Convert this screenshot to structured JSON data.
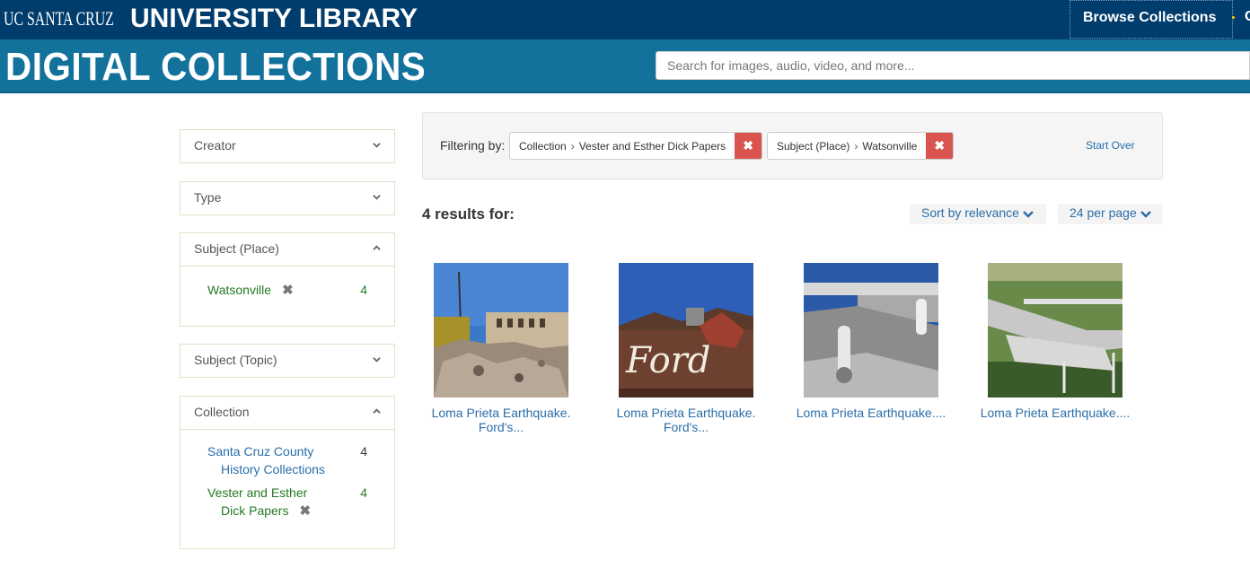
{
  "header": {
    "uc_logo": "UC SANTA CRUZ",
    "library_title": "UNIVERSITY LIBRARY",
    "browse_label": "Browse Collections",
    "more_label": "C"
  },
  "banner": {
    "title": "DIGITAL COLLECTIONS",
    "search_placeholder": "Search for images, audio, video, and more..."
  },
  "facets": {
    "creator": {
      "label": "Creator"
    },
    "type": {
      "label": "Type"
    },
    "subject_place": {
      "label": "Subject (Place)",
      "items": [
        {
          "label": "Watsonville",
          "count": "4"
        }
      ]
    },
    "subject_topic": {
      "label": "Subject (Topic)"
    },
    "collection": {
      "label": "Collection",
      "items": [
        {
          "label": "Santa Cruz County History Collections",
          "count": "4"
        },
        {
          "label": "Vester and Esther Dick Papers",
          "count": "4"
        }
      ]
    }
  },
  "constraints": {
    "label": "Filtering by:",
    "chips": [
      {
        "field": "Collection",
        "value": "Vester and Esther Dick Papers"
      },
      {
        "field": "Subject (Place)",
        "value": "Watsonville"
      }
    ],
    "start_over": "Start Over"
  },
  "results": {
    "count_label": "4 results for:",
    "sort_label": "Sort by relevance",
    "per_page_label": "24 per page",
    "items": [
      {
        "title": "Loma Prieta Earthquake. Ford's..."
      },
      {
        "title": "Loma Prieta Earthquake. Ford's..."
      },
      {
        "title": "Loma Prieta Earthquake...."
      },
      {
        "title": "Loma Prieta Earthquake...."
      }
    ]
  },
  "colors": {
    "top_bar": "#003c6c",
    "banner": "#13729c",
    "link_blue": "#2a6ea9",
    "selected_green": "#267a25",
    "remove_red": "#d9534f"
  }
}
